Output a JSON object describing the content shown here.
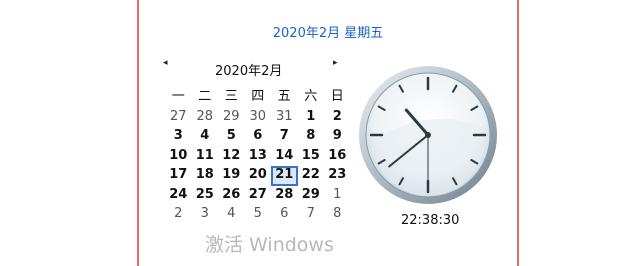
{
  "header": {
    "date_label": "2020年2月 星期五"
  },
  "calendar": {
    "month_title": "2020年2月",
    "prev_icon": "◂",
    "next_icon": "▸",
    "weekdays": [
      "一",
      "二",
      "三",
      "四",
      "五",
      "六",
      "日"
    ],
    "weeks": [
      [
        "27",
        "28",
        "29",
        "30",
        "31",
        "1",
        "2"
      ],
      [
        "3",
        "4",
        "5",
        "6",
        "7",
        "8",
        "9"
      ],
      [
        "10",
        "11",
        "12",
        "13",
        "14",
        "15",
        "16"
      ],
      [
        "17",
        "18",
        "19",
        "20",
        "21",
        "22",
        "23"
      ],
      [
        "24",
        "25",
        "26",
        "27",
        "28",
        "29",
        "1"
      ],
      [
        "2",
        "3",
        "4",
        "5",
        "6",
        "7",
        "8"
      ]
    ],
    "selected_day": "21"
  },
  "clock": {
    "time": "22:38:30"
  },
  "watermark": "激活 Windows"
}
